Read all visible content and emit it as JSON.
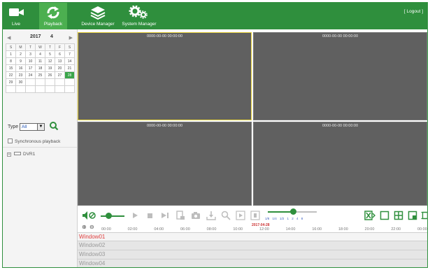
{
  "nav": {
    "live": "Live",
    "playback": "Playback",
    "device_manager": "Device Manager",
    "system_manager": "System Manager",
    "logout": "[ Logout ]"
  },
  "calendar": {
    "year": "2017",
    "month": "4",
    "weekdays": [
      "S",
      "M",
      "T",
      "W",
      "T",
      "F",
      "S"
    ],
    "weeks": [
      [
        "1",
        "2",
        "3",
        "4",
        "5",
        "6",
        "7"
      ],
      [
        "8",
        "9",
        "10",
        "11",
        "12",
        "13",
        "14"
      ],
      [
        "15",
        "16",
        "17",
        "18",
        "19",
        "20",
        "21"
      ],
      [
        "22",
        "23",
        "24",
        "25",
        "26",
        "27",
        "28"
      ],
      [
        "29",
        "30",
        "",
        "",
        "",
        "",
        ""
      ],
      [
        "",
        "",
        "",
        "",
        "",
        "",
        ""
      ]
    ],
    "selected_day": "28"
  },
  "filters": {
    "type_label": "Type",
    "type_value": "All",
    "sync_label": "Synchronous playback"
  },
  "tree": {
    "device": "DVR1"
  },
  "windows": [
    {
      "timestamp": "0000-00-00 00:00:00"
    },
    {
      "timestamp": "0000-00-00 00:00:00"
    },
    {
      "timestamp": "0000-00-00 00:00:00"
    },
    {
      "timestamp": "0000-00-00 00:00:00"
    }
  ],
  "speed": {
    "labels": "1/8 1/4 1/2 1 2 4 8",
    "level": 0.5
  },
  "volume_level": 0.3,
  "timeline": {
    "date": "2017-04-28",
    "ticks": [
      "00:00",
      "02:00",
      "04:00",
      "06:00",
      "08:00",
      "10:00",
      "12:00",
      "14:00",
      "16:00",
      "18:00",
      "20:00",
      "22:00",
      "00:00"
    ],
    "rows": [
      "Window01",
      "Window02",
      "Window03",
      "Window04"
    ]
  },
  "colors": {
    "brand_green": "#2f8f3d",
    "active_border": "#e8d23a",
    "video_bg": "#606060"
  }
}
